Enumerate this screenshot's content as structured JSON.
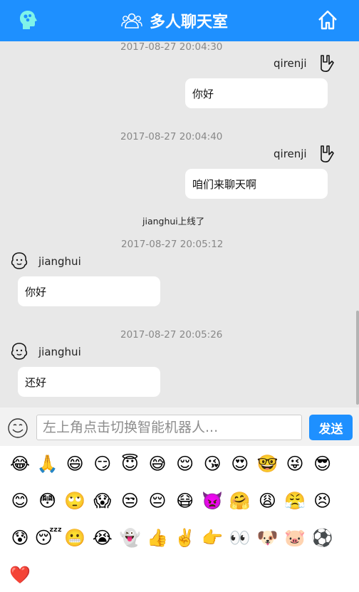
{
  "header": {
    "title": "多人聊天室"
  },
  "messages": [
    {
      "time": "2017-08-27 20:04:30",
      "user": "qirenji",
      "text": "你好",
      "side": "right"
    },
    {
      "time": "2017-08-27 20:04:40",
      "user": "qirenji",
      "text": "咱们来聊天啊",
      "side": "right"
    },
    {
      "time": "2017-08-27 20:05:12",
      "user": "jianghui",
      "text": "你好",
      "side": "left"
    },
    {
      "time": "2017-08-27 20:05:26",
      "user": "jianghui",
      "text": "还好",
      "side": "left"
    }
  ],
  "system_notice": "jianghui上线了",
  "input": {
    "placeholder": "左上角点击切换智能机器人..."
  },
  "send_label": "发送",
  "emojis": [
    "😂",
    "🙏",
    "😄",
    "😏",
    "😇",
    "😅",
    "😌",
    "😘",
    "😍",
    "🤓",
    "😜",
    "😎",
    "😊",
    "😳",
    "🙄",
    "😱",
    "😒",
    "😔",
    "😷",
    "👿",
    "🤗",
    "😩",
    "😤",
    "😣",
    "😰",
    "😴",
    "😬",
    "😭",
    "👻",
    "👍",
    "✌️",
    "👉",
    "👀",
    "🐶",
    "🐷",
    "⚽",
    "❤️"
  ]
}
